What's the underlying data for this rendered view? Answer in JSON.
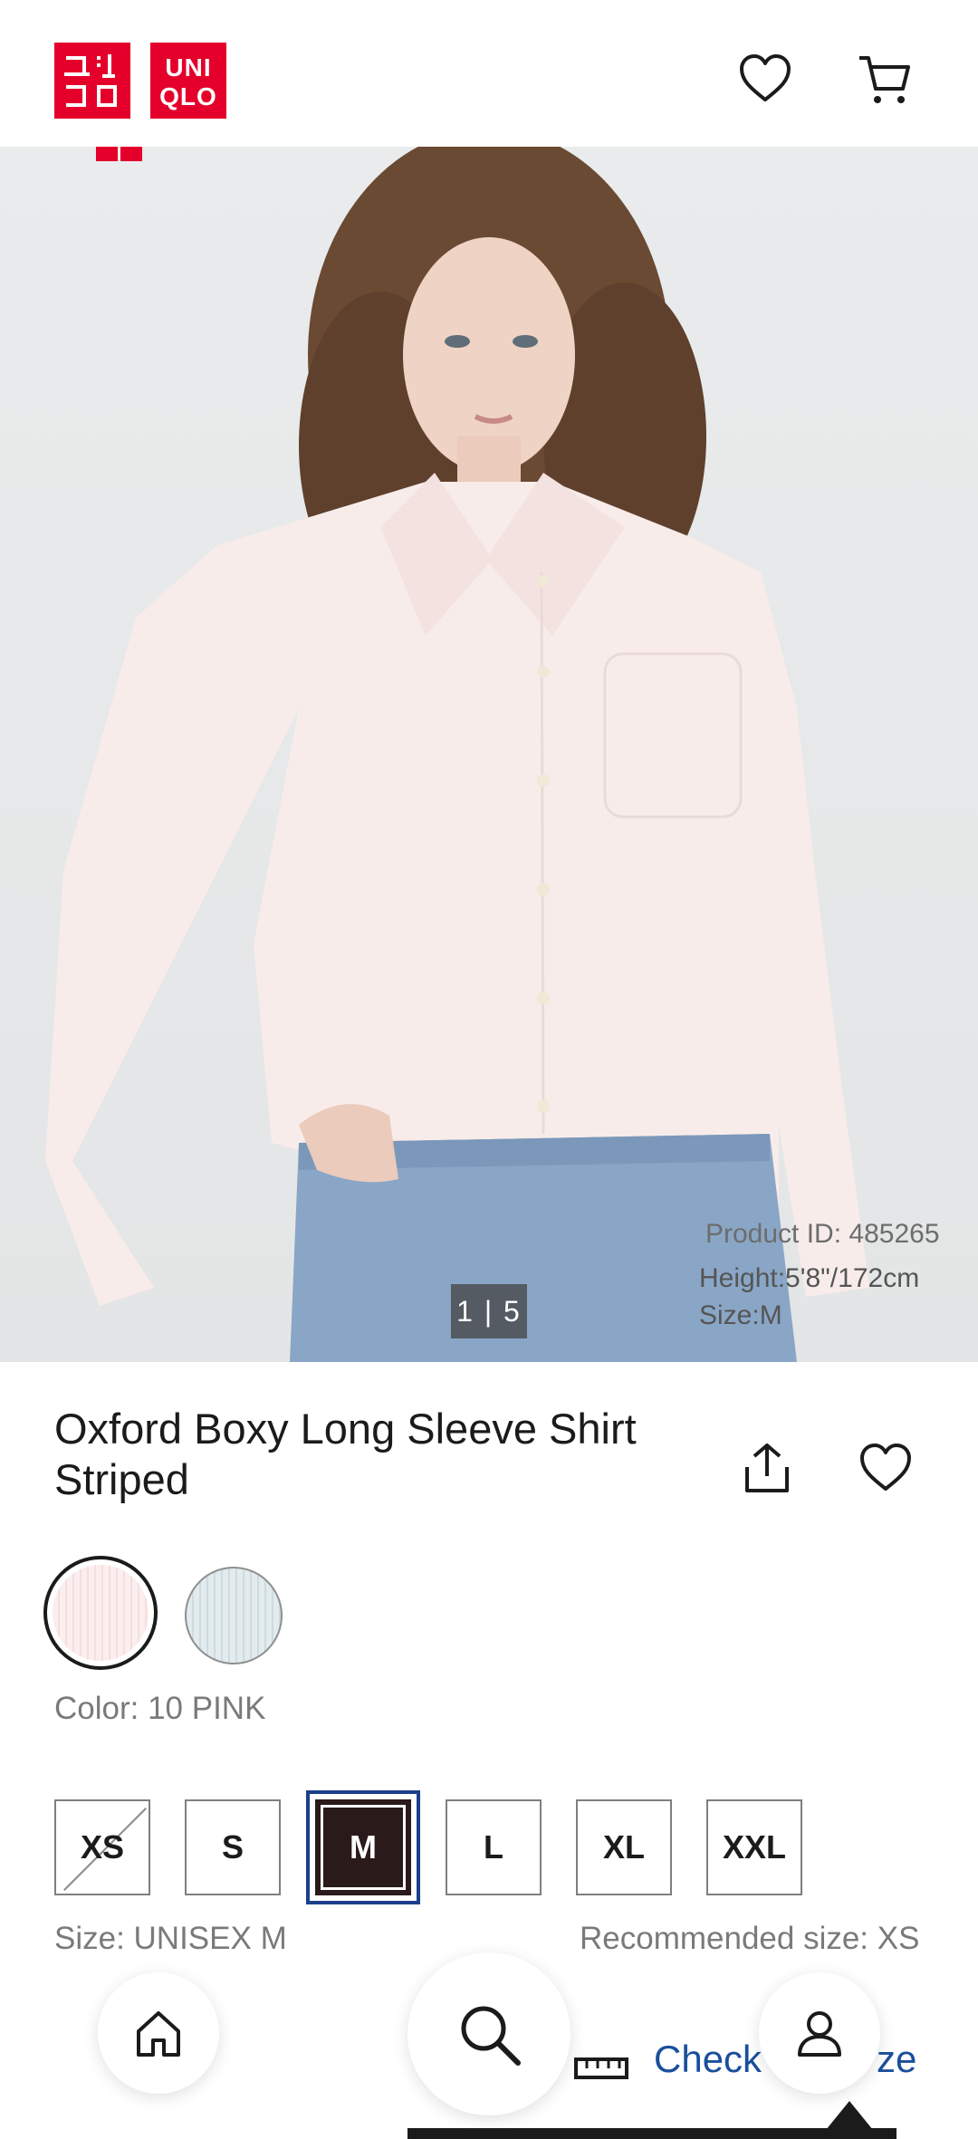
{
  "header": {
    "logo_text_1": "ユニ\nクロ",
    "logo_text_2": "UNI\nQLO",
    "icons": [
      "heart-icon",
      "cart-icon"
    ]
  },
  "product_image": {
    "pager": "1 | 5",
    "product_id": "Product ID: 485265",
    "model_height": "Height:5'8\"/172cm",
    "model_size": "Size:M"
  },
  "product": {
    "title": "Oxford Boxy Long Sleeve Shirt Striped",
    "color_label": "Color: 10 PINK",
    "size_label": "Size: UNISEX M",
    "recommended_size": "Recommended size: XS",
    "sizes": [
      "XS",
      "S",
      "M",
      "L",
      "XL",
      "XXL"
    ],
    "selected_size": "M",
    "unavailable_sizes": [
      "XS"
    ]
  },
  "fit": {
    "check_label": "Check",
    "size_suffix": "ze"
  },
  "bottom_nav": [
    "home-icon",
    "search-icon",
    "account-icon"
  ],
  "colors": {
    "brand": "#e4002b",
    "link": "#1a4f9c",
    "selected": "#2a1a1a"
  }
}
